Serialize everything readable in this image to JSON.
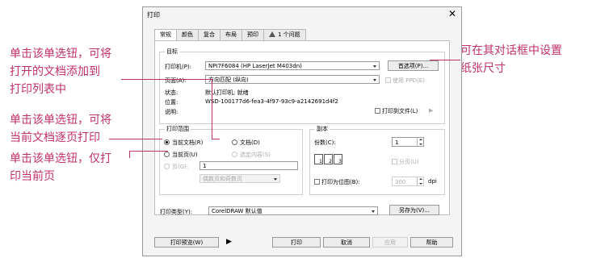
{
  "annotations": {
    "add_to_list": [
      "单击该单选钮，可将",
      "打开的文档添加到",
      "打印列表中"
    ],
    "current_doc": [
      "单击该单选钮，可将",
      "当前文档逐页打印"
    ],
    "current_page": [
      "单击该单选钮，仅打",
      "印当前页"
    ],
    "preferences": [
      "可在其对话框中设置",
      "纸张尺寸"
    ]
  },
  "dialog": {
    "title": "打印",
    "close": "✕",
    "tabs": [
      "常规",
      "颜色",
      "复合",
      "布局",
      "预印",
      "1 个问题"
    ],
    "target": {
      "title": "目标",
      "printer_label": "打印机(P):",
      "printer_value": "NPI7F6084 (HP LaserJet M403dn)",
      "preferences_button": "首选项(P)...",
      "page_label": "页面(A):",
      "page_value": "方向匹配 (纵向)",
      "use_ppd": "使用 PPD(E)",
      "status_label": "状态:",
      "status_value": "默认打印机; 就绪",
      "location_label": "位置:",
      "location_value": "WSD-100177d6-fea3-4f97-93c9-a2142691d4f2",
      "comment_label": "说明:",
      "print_to_file": "打印到文件(L)",
      "print_to_file_arrow": "▶"
    },
    "range": {
      "title": "打印范围",
      "current_document": "当前文档(R)",
      "documents": "文档(D)",
      "current_page": "当前页(U)",
      "selection": "选定内容(S)",
      "pages": "页(G):",
      "pages_value": "1",
      "even_odd": "偶数页和奇数页"
    },
    "copies": {
      "title": "副本",
      "count_label": "份数(C):",
      "count_value": "1",
      "collate": "分页(U)",
      "collate_pages": [
        "1",
        "2",
        "3"
      ],
      "print_bitmap": "打印为位图(B):",
      "dpi_value": "300",
      "dpi_unit": "dpi"
    },
    "print_style_label": "打印类型(Y):",
    "print_style_value": "CorelDRAW 默认值",
    "save_as": "另存为(V)...",
    "buttons": {
      "preview": "打印预览(W)",
      "preview_arrow": "▶",
      "print": "打印",
      "cancel": "取消",
      "apply": "应用",
      "help": "帮助"
    }
  }
}
